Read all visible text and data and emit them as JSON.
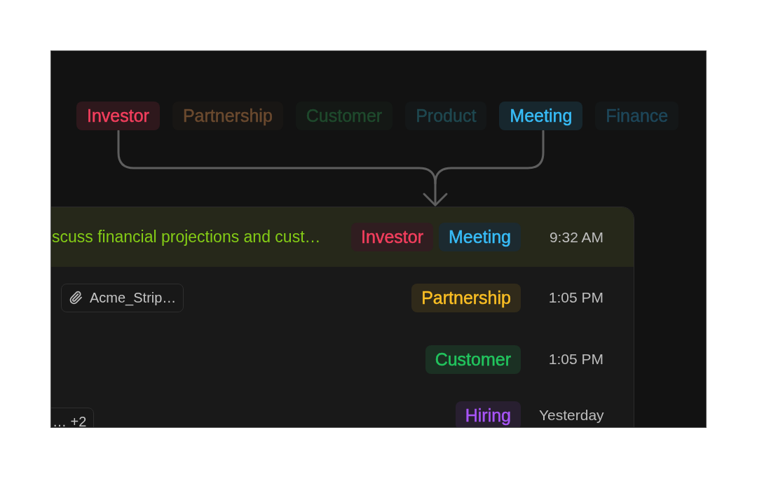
{
  "tag_filter": [
    {
      "label": "Investor",
      "selected": true,
      "color": "#f43f5e"
    },
    {
      "label": "Partnership",
      "selected": false,
      "color": "#6b4a2f"
    },
    {
      "label": "Customer",
      "selected": false,
      "color": "#1f4a2d"
    },
    {
      "label": "Product",
      "selected": false,
      "color": "#1f4850"
    },
    {
      "label": "Meeting",
      "selected": true,
      "color": "#38bdf8"
    },
    {
      "label": "Finance",
      "selected": false,
      "color": "#1e475a"
    }
  ],
  "messages": [
    {
      "highlighted": true,
      "preview": "scuss financial projections and cust…",
      "tags": [
        {
          "label": "Investor",
          "color": "#f43f5e"
        },
        {
          "label": "Meeting",
          "color": "#38bdf8"
        }
      ],
      "time": "9:32 AM"
    },
    {
      "highlighted": false,
      "attachment": {
        "kind": "file",
        "label": "Acme_Strip…"
      },
      "tags": [
        {
          "label": "Partnership",
          "color": "#fbbf24"
        }
      ],
      "time": "1:05 PM"
    },
    {
      "highlighted": false,
      "tags": [
        {
          "label": "Customer",
          "color": "#22c55e"
        }
      ],
      "time": "1:05 PM"
    },
    {
      "highlighted": false,
      "attachment": {
        "kind": "overflow",
        "label": "… +2"
      },
      "tags": [
        {
          "label": "Hiring",
          "color": "#a855f7"
        }
      ],
      "time": "Yesterday"
    }
  ]
}
